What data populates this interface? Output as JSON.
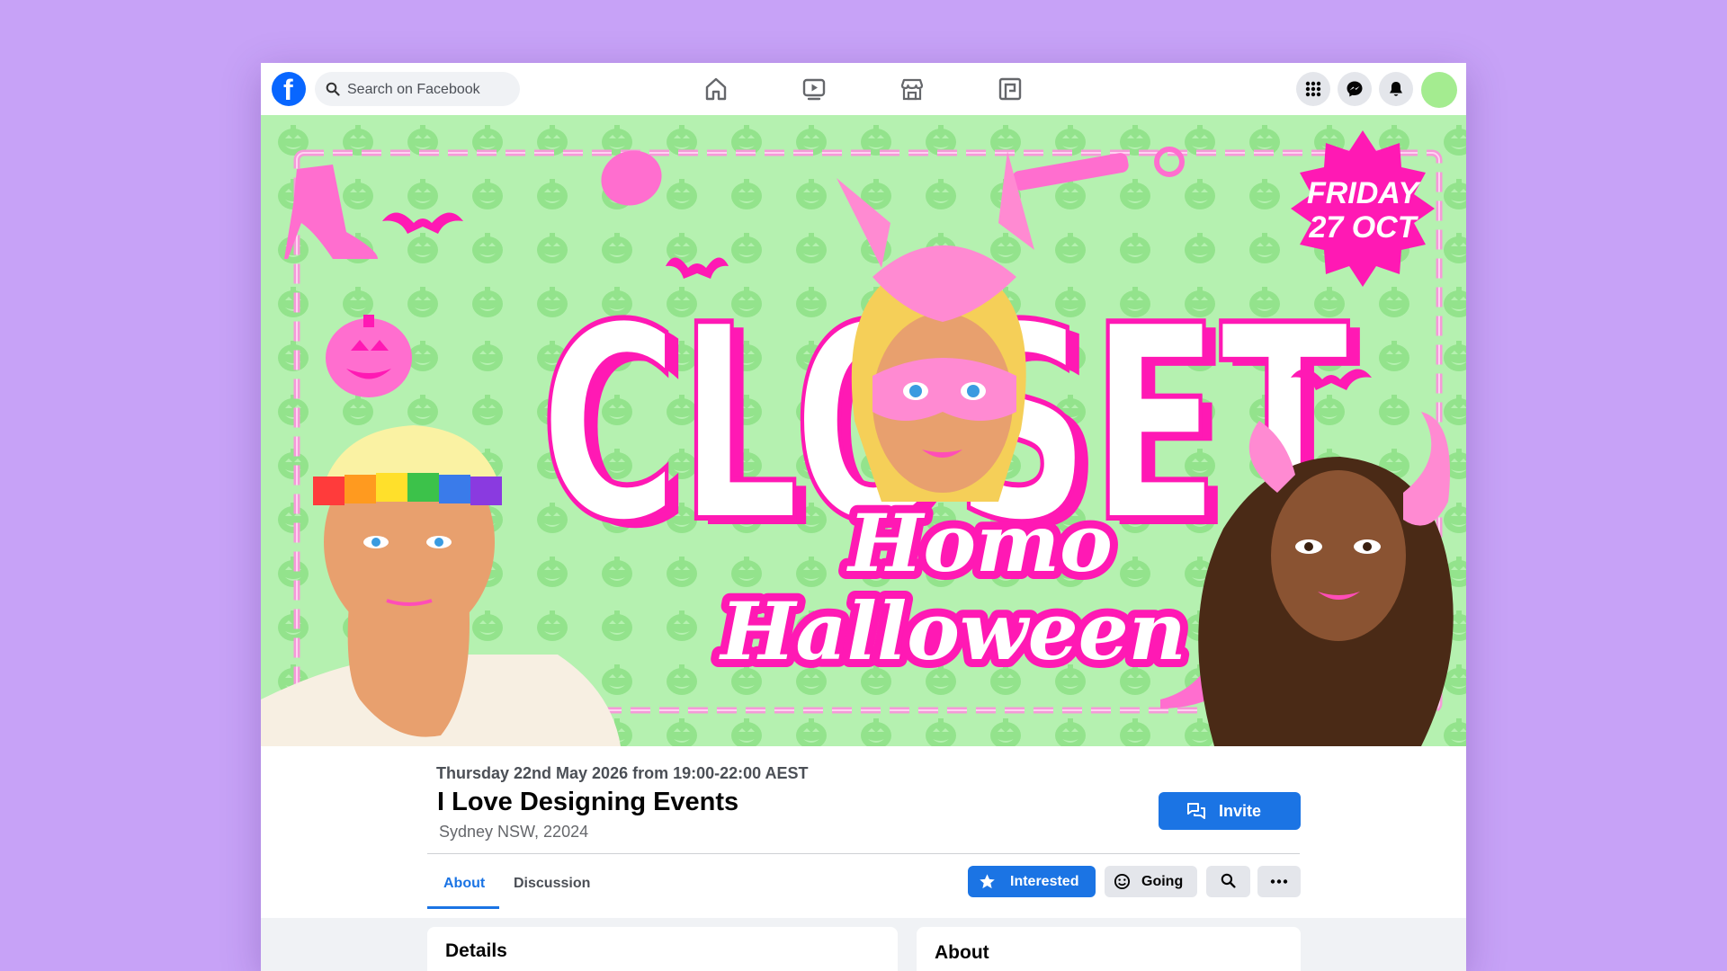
{
  "search": {
    "placeholder": "Search on Facebook"
  },
  "nav": {
    "center_icons": [
      "home-icon",
      "watch-icon",
      "marketplace-icon",
      "gaming-icon"
    ],
    "right_icons": [
      "menu-grid-icon",
      "messenger-icon",
      "notifications-icon"
    ]
  },
  "cover": {
    "title": "CLOSET",
    "subtitle_line1": "Homo",
    "subtitle_line2": "Halloween",
    "badge_line1": "FRIDAY",
    "badge_line2": "27 OCT"
  },
  "event": {
    "date": "Thursday 22nd May 2026 from 19:00-22:00 AEST",
    "title": "I Love Designing Events",
    "location": "Sydney NSW, 22024",
    "invite_label": "Invite"
  },
  "tabs": [
    {
      "label": "About",
      "active": true
    },
    {
      "label": "Discussion",
      "active": false
    }
  ],
  "actions": {
    "interested_label": "Interested",
    "going_label": "Going"
  },
  "cards": {
    "details_title": "Details",
    "about_title": "About"
  },
  "colors": {
    "page_bg": "#c7a2f7",
    "facebook_blue": "#1b74e4",
    "cover_bg": "#b5f1b0",
    "cover_pink": "#ff19b4",
    "avatar": "#a4ec90"
  }
}
